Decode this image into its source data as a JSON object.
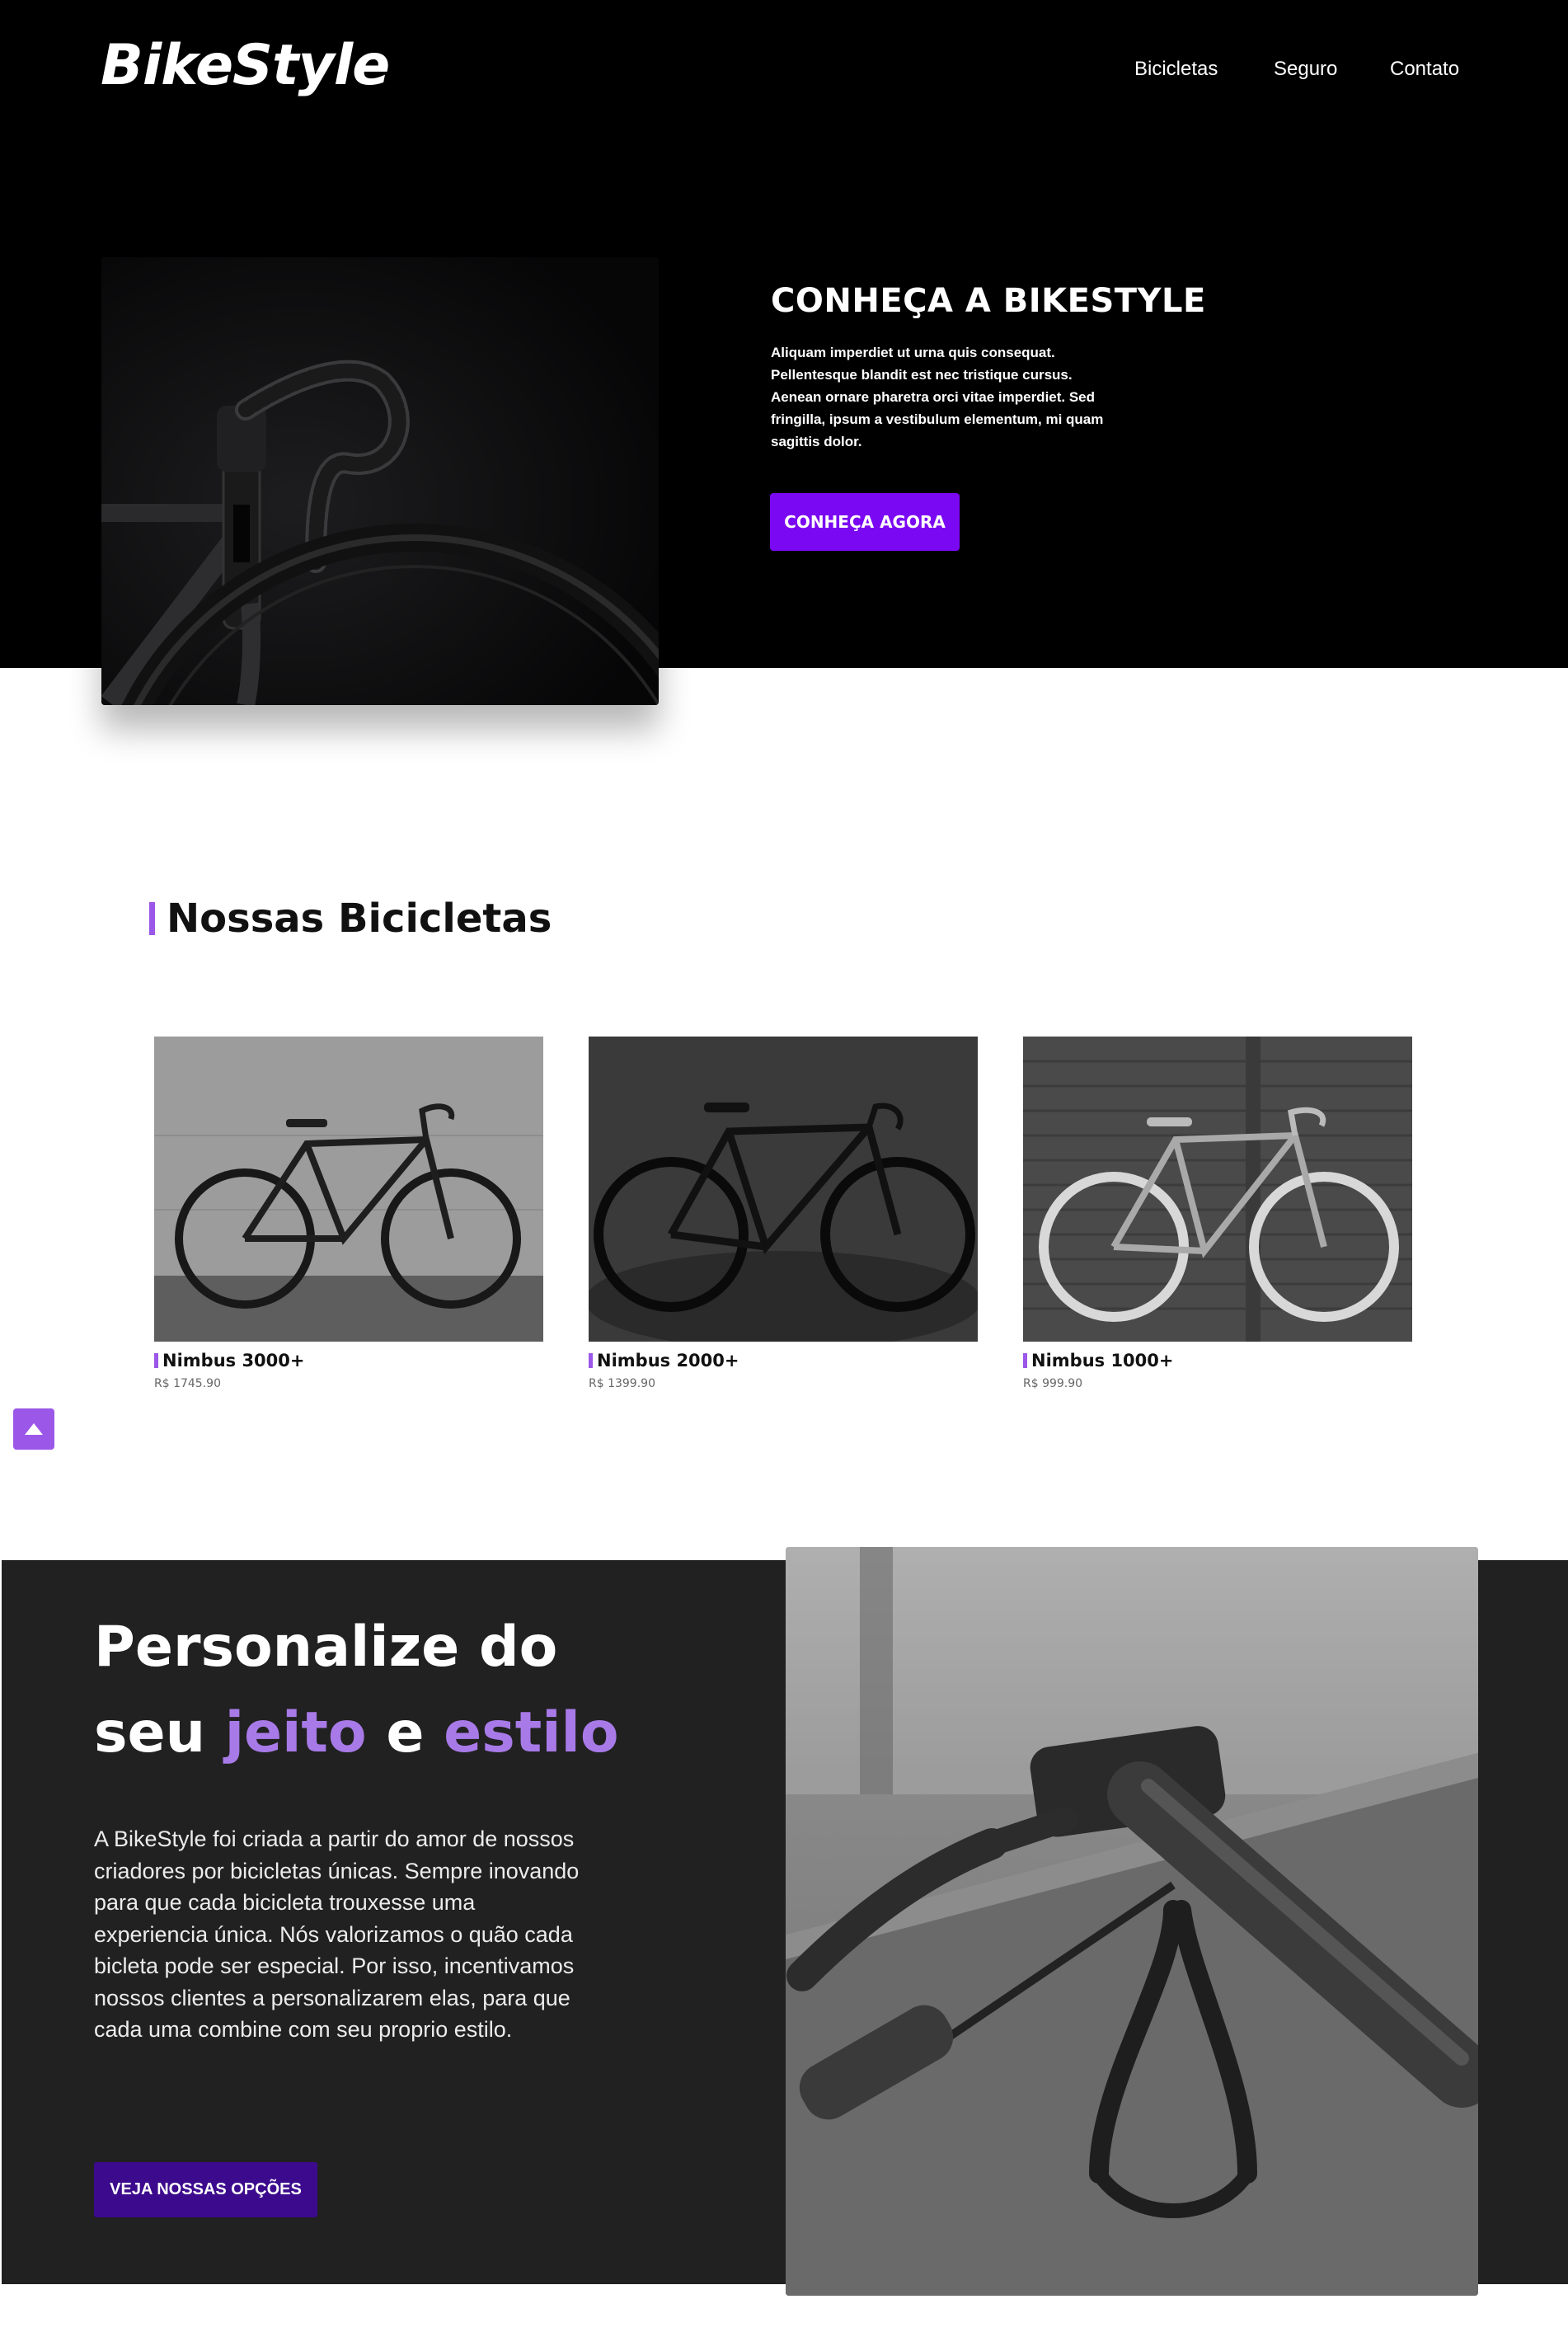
{
  "header": {
    "logo": "BikeStyle",
    "nav": [
      "Bicicletas",
      "Seguro",
      "Contato"
    ]
  },
  "hero": {
    "title": "CONHEÇA A BIKESTYLE",
    "text": "Aliquam imperdiet ut urna quis consequat. Pellentesque blandit est nec tristique cursus. Aenean ornare pharetra orci vitae imperdiet. Sed fringilla, ipsum a vestibulum elementum, mi quam sagittis dolor.",
    "button": "CONHEÇA AGORA"
  },
  "bikes": {
    "title": "Nossas Bicicletas",
    "items": [
      {
        "name": "Nimbus 3000+",
        "price": "R$ 1745.90"
      },
      {
        "name": "Nimbus 2000+",
        "price": "R$ 1399.90"
      },
      {
        "name": "Nimbus 1000+",
        "price": "R$ 999.90"
      }
    ]
  },
  "personalize": {
    "title_line1": "Personalize do",
    "title_line2_a": "seu ",
    "title_accent1": "jeito",
    "title_mid": " e ",
    "title_accent2": "estilo",
    "text": "A BikeStyle foi criada a partir do amor de nossos criadores por bicicletas únicas. Sempre inovando para que cada bicicleta trouxesse uma experiencia única. Nós valorizamos o quão cada bicleta pode ser especial. Por isso, incentivamos nossos clientes a personalizarem elas, para que cada uma combine com seu proprio estilo.",
    "button": "VEJA NOSSAS OPÇÕES"
  },
  "colors": {
    "accent": "#7b08f2",
    "accent_light": "#9b57e8",
    "dark_button": "#3c0a8c",
    "dark_section": "#212121"
  },
  "icons": {
    "scroll_top": "arrow-up-icon"
  }
}
